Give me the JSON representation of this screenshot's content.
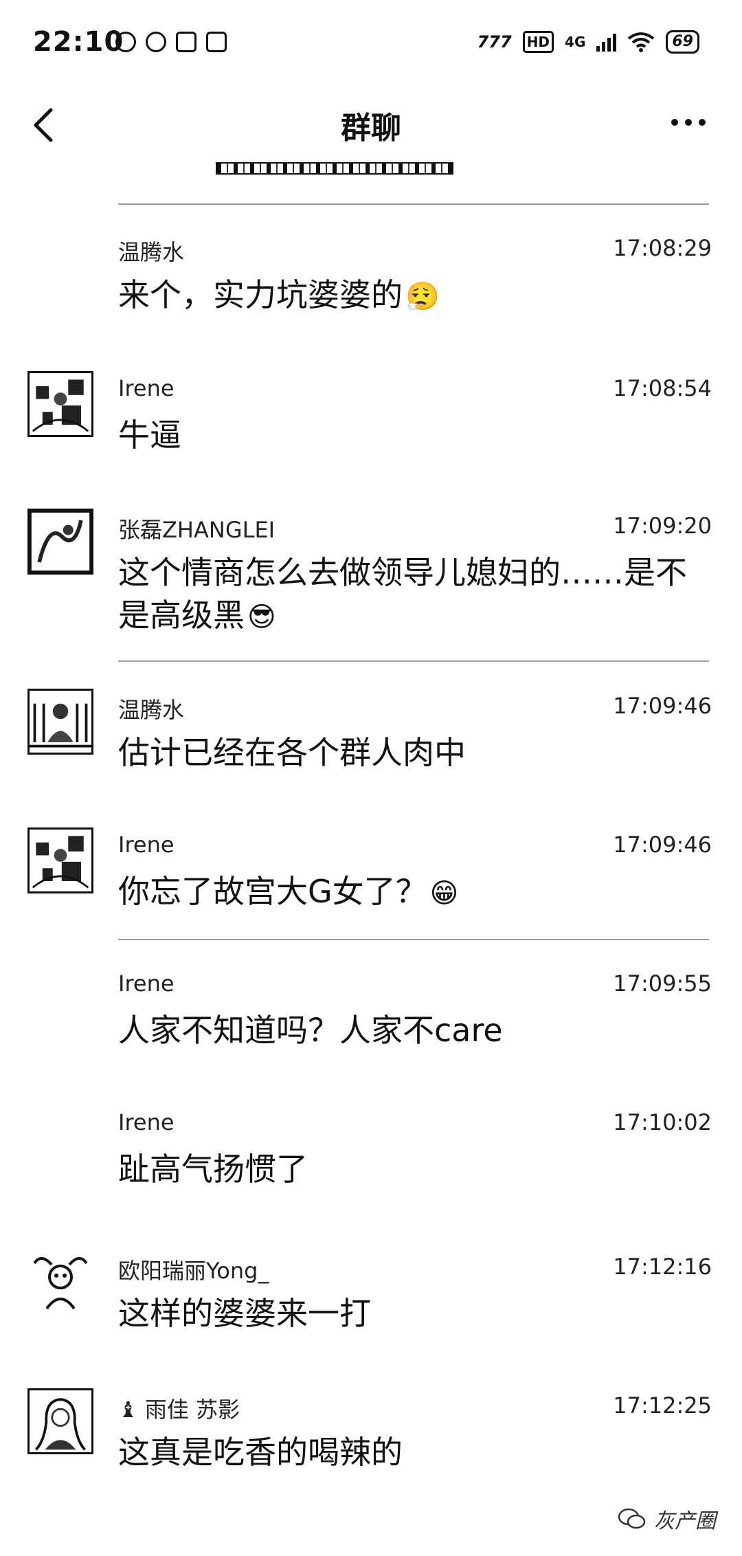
{
  "status_bar": {
    "time": "22:10",
    "network": "4G",
    "hd": "HD",
    "battery": "69"
  },
  "nav": {
    "title": "群聊"
  },
  "messages": [
    {
      "sender": "温腾水",
      "time": "17:08:29",
      "text": "来个，实力坑婆婆的",
      "emoji": "😮‍💨"
    },
    {
      "sender": "Irene",
      "time": "17:08:54",
      "text": "牛逼",
      "emoji": ""
    },
    {
      "sender": "张磊ZHANGLEI",
      "time": "17:09:20",
      "text": "这个情商怎么去做领导儿媳妇的……是不是高级黑",
      "emoji": "😎"
    },
    {
      "sender": "温腾水",
      "time": "17:09:46",
      "text": "估计已经在各个群人肉中",
      "emoji": ""
    },
    {
      "sender": "Irene",
      "time": "17:09:46",
      "text": "你忘了故宫大G女了？",
      "emoji": "😁"
    },
    {
      "sender": "Irene",
      "time": "17:09:55",
      "text": "人家不知道吗？人家不care",
      "emoji": ""
    },
    {
      "sender": "Irene",
      "time": "17:10:02",
      "text": "趾高气扬惯了",
      "emoji": ""
    },
    {
      "sender": "欧阳瑞丽Yong_",
      "time": "17:12:16",
      "text": "这样的婆婆来一打",
      "emoji": ""
    },
    {
      "sender": "雨佳 苏影",
      "time": "17:12:25",
      "text": "这真是吃香的喝辣的",
      "emoji": ""
    }
  ],
  "watermark": {
    "text": "灰产圈"
  },
  "icons": {
    "back": "chevron-left-icon",
    "more": "more-horizontal-icon",
    "wifi": "wifi-icon",
    "signal": "signal-icon",
    "battery": "battery-icon"
  }
}
